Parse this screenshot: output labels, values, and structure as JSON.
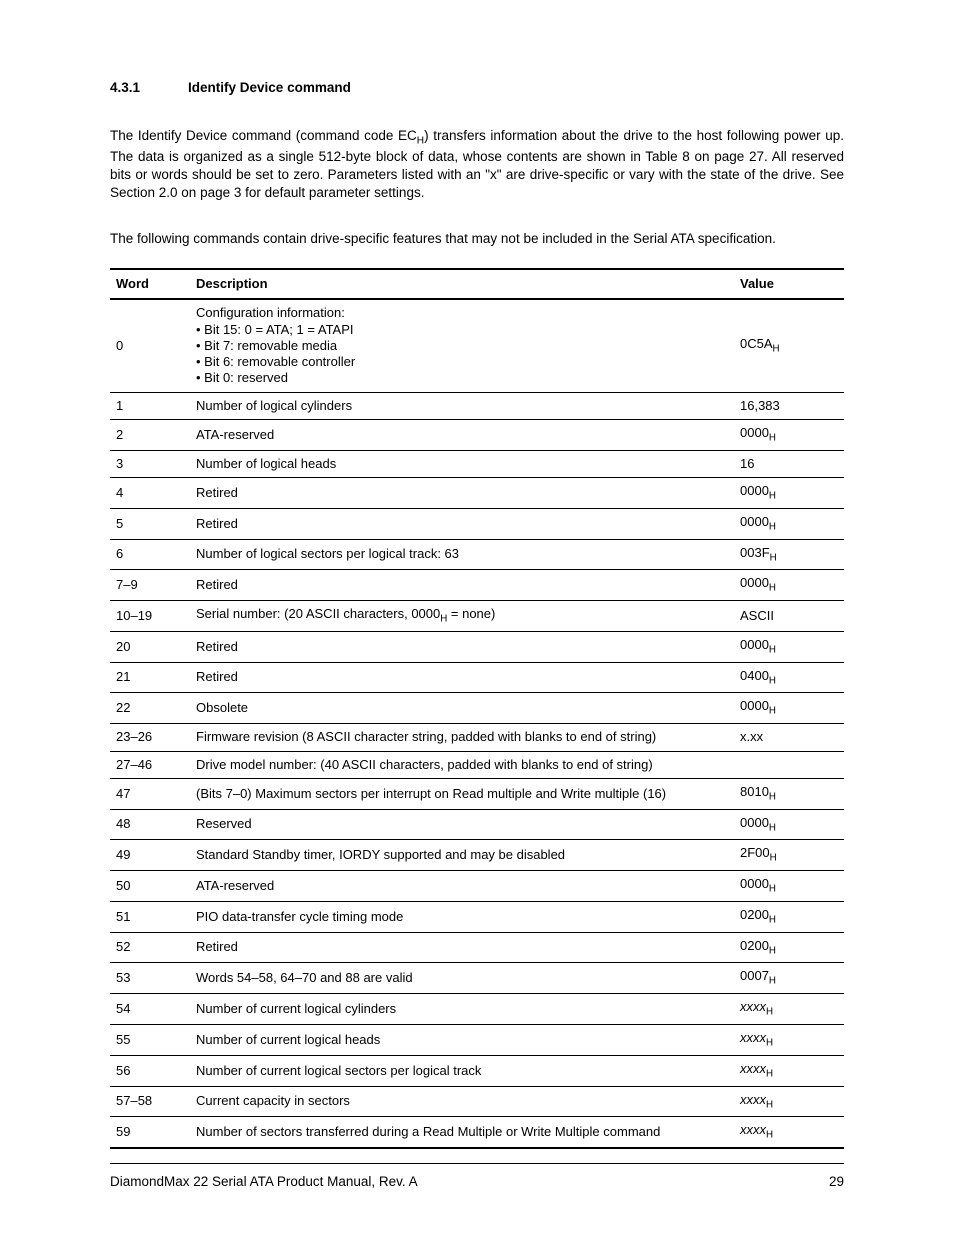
{
  "heading": {
    "number": "4.3.1",
    "title": "Identify Device command"
  },
  "para1_a": "The Identify Device command (command code EC",
  "para1_b": ") transfers information about the drive to the host following power up. The data is organized as a single 512-byte block of data, whose contents are shown in Table 8 on page 27. All reserved bits or words should be set to zero. Parameters listed with an \"x\" are drive-specific or vary with the state of the drive. See Section 2.0 on page 3 for default parameter settings.",
  "para2": "The following commands contain drive-specific features that may not be included in the Serial ATA specification.",
  "columns": {
    "word": "Word",
    "desc": "Description",
    "value": "Value"
  },
  "rows": [
    {
      "word": "0",
      "desc": "Configuration information:\n• Bit 15: 0 = ATA; 1 = ATAPI\n• Bit 7: removable media\n• Bit 6: removable controller\n• Bit 0: reserved",
      "value": "0C5A",
      "value_sub": "H"
    },
    {
      "word": "1",
      "desc": "Number of logical cylinders",
      "value": "16,383"
    },
    {
      "word": "2",
      "desc": "ATA-reserved",
      "value": "0000",
      "value_sub": "H"
    },
    {
      "word": "3",
      "desc": "Number of logical heads",
      "value": "16"
    },
    {
      "word": "4",
      "desc": "Retired",
      "value": "0000",
      "value_sub": "H"
    },
    {
      "word": "5",
      "desc": "Retired",
      "value": "0000",
      "value_sub": "H"
    },
    {
      "word": "6",
      "desc": "Number of logical sectors per logical track: 63",
      "value": "003F",
      "value_sub": "H"
    },
    {
      "word": "7–9",
      "desc": "Retired",
      "value": "0000",
      "value_sub": "H"
    },
    {
      "word": "10–19",
      "desc_a": "Serial number: (20 ASCII characters, 0000",
      "desc_sub": "H",
      "desc_b": " = none)",
      "value": "ASCII"
    },
    {
      "word": "20",
      "desc": "Retired",
      "value": "0000",
      "value_sub": "H"
    },
    {
      "word": "21",
      "desc": "Retired",
      "value": "0400",
      "value_sub": "H"
    },
    {
      "word": "22",
      "desc": "Obsolete",
      "value": "0000",
      "value_sub": "H"
    },
    {
      "word": "23–26",
      "desc": "Firmware revision (8 ASCII character string, padded with blanks to end of string)",
      "value": "x.xx"
    },
    {
      "word": "27–46",
      "desc": "Drive model number: (40 ASCII characters, padded with blanks to end of string)",
      "value": ""
    },
    {
      "word": "47",
      "desc": "(Bits 7–0) Maximum sectors per interrupt on Read multiple and Write multiple (16)",
      "value": "8010",
      "value_sub": "H"
    },
    {
      "word": "48",
      "desc": "Reserved",
      "value": "0000",
      "value_sub": "H"
    },
    {
      "word": "49",
      "desc": "Standard Standby timer, IORDY supported and may be disabled",
      "value": "2F00",
      "value_sub": "H"
    },
    {
      "word": "50",
      "desc": "ATA-reserved",
      "value": "0000",
      "value_sub": "H"
    },
    {
      "word": "51",
      "desc": "PIO data-transfer cycle  timing mode",
      "value": "0200",
      "value_sub": "H"
    },
    {
      "word": "52",
      "desc": "Retired",
      "value": "0200",
      "value_sub": "H"
    },
    {
      "word": "53",
      "desc": "Words 54–58, 64–70 and 88 are valid",
      "value": "0007",
      "value_sub": "H"
    },
    {
      "word": "54",
      "desc": "Number of current logical  cylinders",
      "value_italic": "xxxx",
      "value_sub": "H"
    },
    {
      "word": "55",
      "desc": "Number of current logical heads",
      "value_italic": "xxxx",
      "value_sub": "H"
    },
    {
      "word": "56",
      "desc": "Number of current logical sectors per logical track",
      "value_italic": "xxxx",
      "value_sub": "H"
    },
    {
      "word": "57–58",
      "desc": "Current capacity in sectors",
      "value_italic": "xxxx",
      "value_sub": "H"
    },
    {
      "word": "59",
      "desc": "Number of sectors transferred during a Read Multiple or Write Multiple command",
      "value_italic": "xxxx",
      "value_sub": "H"
    }
  ],
  "footer": {
    "left": "DiamondMax 22 Serial ATA Product Manual, Rev. A",
    "right": "29"
  }
}
